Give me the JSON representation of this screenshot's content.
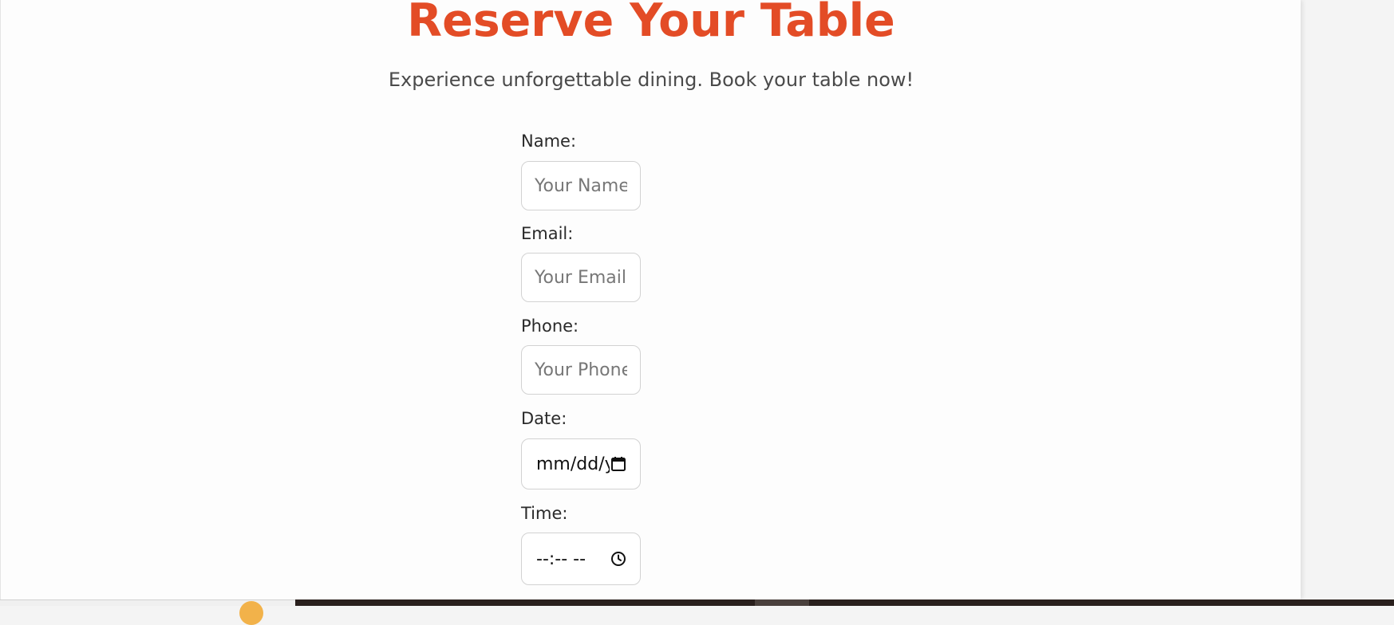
{
  "header": {
    "title": "Reserve Your Table",
    "subtitle": "Experience unforgettable dining. Book your table now!"
  },
  "form": {
    "name": {
      "label": "Name:",
      "placeholder": "Your Name",
      "value": ""
    },
    "email": {
      "label": "Email:",
      "placeholder": "Your Email",
      "value": ""
    },
    "phone": {
      "label": "Phone:",
      "placeholder": "Your Phone",
      "value": ""
    },
    "date": {
      "label": "Date:",
      "display": "mm/dd/yyyy",
      "icon": "calendar-icon"
    },
    "time": {
      "label": "Time:",
      "display": "--:-- --",
      "icon": "clock-icon"
    }
  },
  "colors": {
    "accent": "#e34c26",
    "text": "#2a2a2a",
    "muted": "#4a4a4a",
    "placeholder": "#777777",
    "border": "#d2d2d2"
  }
}
